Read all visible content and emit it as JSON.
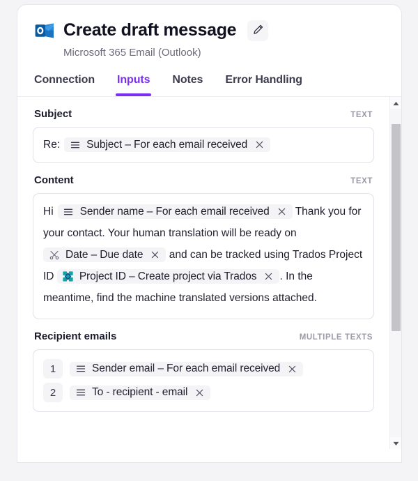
{
  "header": {
    "app_icon": "outlook-icon",
    "title": "Create draft message",
    "subtitle": "Microsoft 365 Email (Outlook)",
    "edit_icon": "pencil-icon"
  },
  "tabs": [
    {
      "label": "Connection",
      "active": false
    },
    {
      "label": "Inputs",
      "active": true
    },
    {
      "label": "Notes",
      "active": false
    },
    {
      "label": "Error Handling",
      "active": false
    }
  ],
  "fields": {
    "subject": {
      "label": "Subject",
      "type_badge": "TEXT",
      "prefix_text": "Re:",
      "chip": {
        "icon": "text-variable-icon",
        "label": "Subject – For each email received",
        "remove_icon": "close-icon"
      }
    },
    "content": {
      "label": "Content",
      "type_badge": "TEXT",
      "line1_prefix": "Hi",
      "chip_sender": {
        "icon": "text-variable-icon",
        "label": "Sender name – For each email received",
        "remove_icon": "close-icon"
      },
      "text_after_sender": "Thank you for your contact. Your human translation will be ready on",
      "chip_date": {
        "icon": "tools-icon",
        "label": "Date – Due date",
        "remove_icon": "close-icon"
      },
      "text_after_date": "and can be tracked using Trados Project ID",
      "chip_project": {
        "icon": "trados-icon",
        "label": "Project ID – Create project via Trados",
        "remove_icon": "close-icon"
      },
      "text_after_project": ". In the meantime, find the machine translated versions attached."
    },
    "recipient_emails": {
      "label": "Recipient emails",
      "type_badge": "MULTIPLE TEXTS",
      "rows": [
        {
          "number": "1",
          "chip": {
            "icon": "text-variable-icon",
            "label": "Sender email – For each email received",
            "remove_icon": "close-icon"
          }
        },
        {
          "number": "2",
          "chip": {
            "icon": "text-variable-icon",
            "label": "To - recipient - email",
            "remove_icon": "close-icon"
          }
        }
      ]
    }
  },
  "scrollbar": {
    "up_icon": "triangle-up-icon",
    "down_icon": "triangle-down-icon",
    "thumb": "scroll-thumb"
  },
  "colors": {
    "accent": "#7b2ff2",
    "text_primary": "#20202e",
    "text_muted": "#9a9aa8",
    "chip_bg": "#f4f4f7",
    "outlook_blue": "#0f6cbd",
    "trados_teal": "#12a5a5"
  }
}
